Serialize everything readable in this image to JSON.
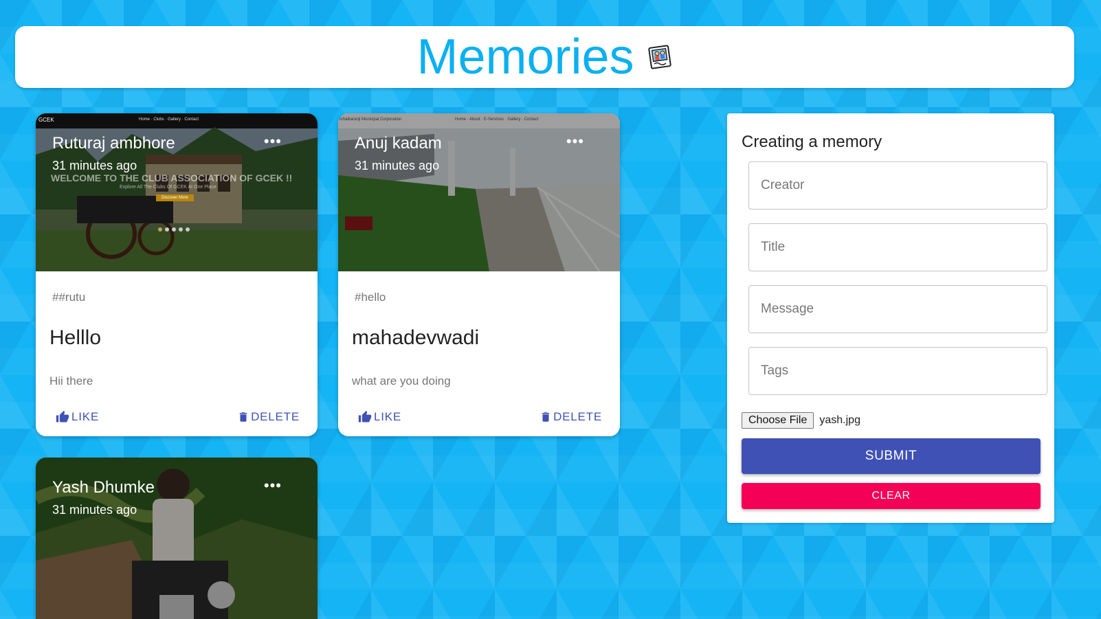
{
  "app": {
    "title": "Memories",
    "icon": "memories-photo-icon",
    "accent_color": "#0cb0f0"
  },
  "posts": [
    {
      "creator": "Ruturaj ambhore",
      "time": "31 minutes ago",
      "tags": "##rutu",
      "title": "Helllo",
      "message": "Hii there",
      "like_label": "LIKE",
      "delete_label": "DELETE",
      "image_texts": {
        "brand": "GCEK",
        "nav": "Home · Clubs · Gallery · Contact",
        "headline": "WELCOME TO THE CLUB ASSOCIATION OF GCEK !!",
        "subline": "Explore All The Clubs Of GCEK At One Place",
        "button": "Discover More"
      }
    },
    {
      "creator": "Anuj kadam",
      "time": "31 minutes ago",
      "tags": "#hello",
      "title": "mahadevwadi",
      "message": "what are you doing",
      "like_label": "LIKE",
      "delete_label": "DELETE",
      "image_texts": {
        "brand": "Ichalkaranji Municipal Corporation",
        "nav": "Home · About · E-Services · Gallery · Contact"
      }
    },
    {
      "creator": "Yash Dhumke",
      "time": "31 minutes ago"
    }
  ],
  "form": {
    "heading": "Creating a memory",
    "creator_placeholder": "Creator",
    "title_placeholder": "Title",
    "message_placeholder": "Message",
    "tags_placeholder": "Tags",
    "file_button": "Choose File",
    "file_name": "yash.jpg",
    "submit_label": "SUBMIT",
    "clear_label": "CLEAR",
    "submit_color": "#3f51b5",
    "clear_color": "#f50057"
  }
}
